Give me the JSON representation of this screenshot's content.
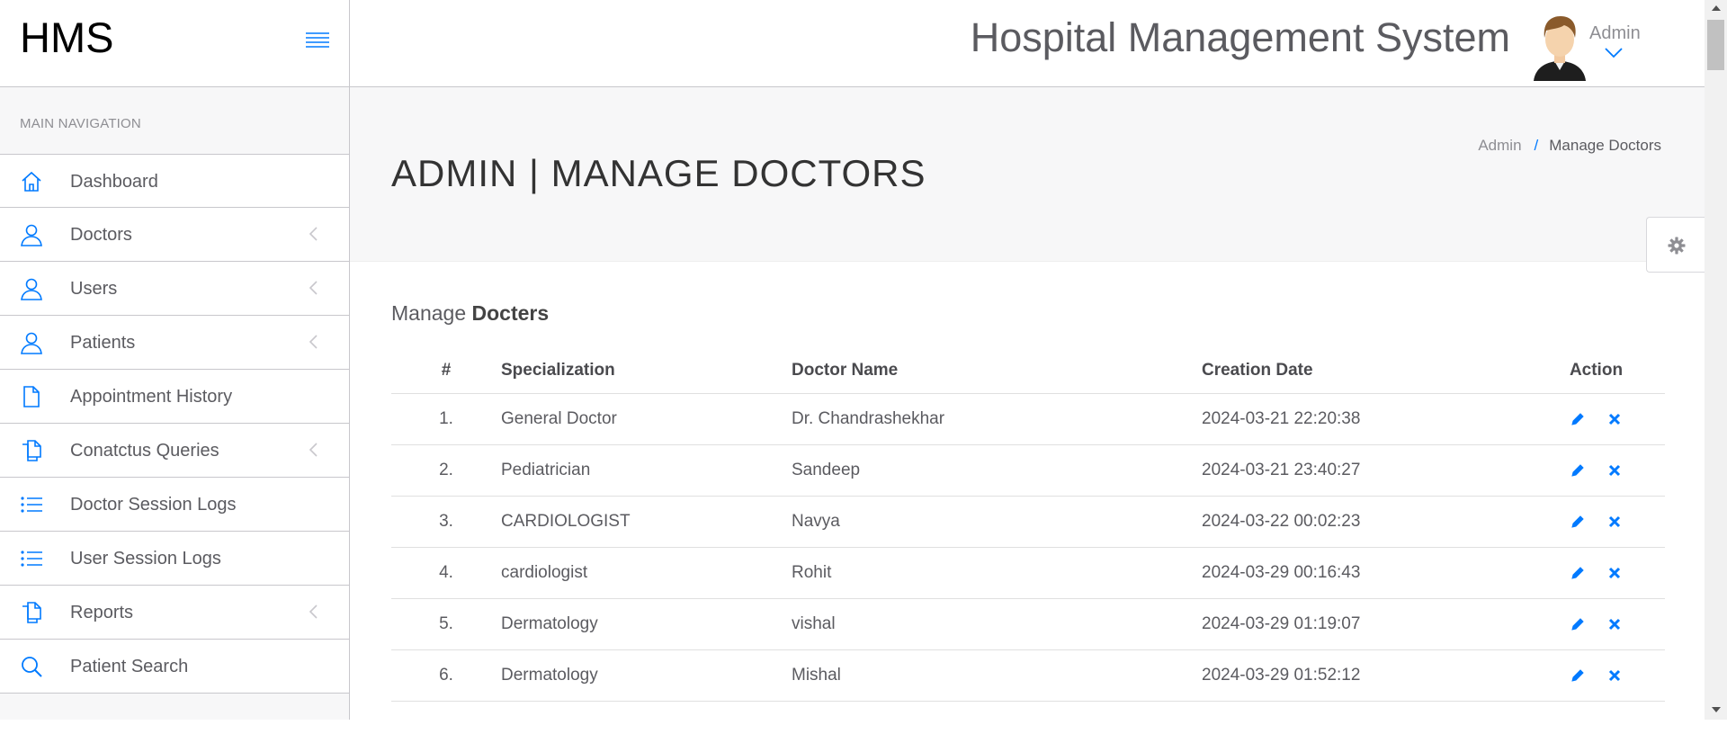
{
  "brand": {
    "logo": "HMS"
  },
  "topbar": {
    "title": "Hospital Management System",
    "user_name": "Admin"
  },
  "sidebar": {
    "header": "MAIN NAVIGATION",
    "items": [
      {
        "label": "Dashboard",
        "icon": "home-icon",
        "has_submenu": false
      },
      {
        "label": "Doctors",
        "icon": "user-icon",
        "has_submenu": true
      },
      {
        "label": "Users",
        "icon": "user-icon",
        "has_submenu": true
      },
      {
        "label": "Patients",
        "icon": "user-icon",
        "has_submenu": true
      },
      {
        "label": "Appointment History",
        "icon": "file-icon",
        "has_submenu": false
      },
      {
        "label": "Conatctus Queries",
        "icon": "files-icon",
        "has_submenu": true
      },
      {
        "label": "Doctor Session Logs",
        "icon": "list-icon",
        "has_submenu": false
      },
      {
        "label": "User Session Logs",
        "icon": "list-icon",
        "has_submenu": false
      },
      {
        "label": "Reports",
        "icon": "files-icon",
        "has_submenu": true
      },
      {
        "label": "Patient Search",
        "icon": "search-icon",
        "has_submenu": false
      }
    ]
  },
  "page": {
    "title": "ADMIN | MANAGE DOCTORS",
    "breadcrumb": {
      "root": "Admin",
      "separator": "/",
      "current": "Manage Doctors"
    }
  },
  "panel": {
    "title_prefix": "Manage",
    "title_bold": "Docters"
  },
  "table": {
    "headers": {
      "num": "#",
      "spec": "Specialization",
      "name": "Doctor Name",
      "date": "Creation Date",
      "action": "Action"
    },
    "rows": [
      {
        "num": "1.",
        "spec": "General Doctor",
        "name": "Dr. Chandrashekhar",
        "date": "2024-03-21 22:20:38"
      },
      {
        "num": "2.",
        "spec": "Pediatrician",
        "name": "Sandeep",
        "date": "2024-03-21 23:40:27"
      },
      {
        "num": "3.",
        "spec": "CARDIOLOGIST",
        "name": "Navya",
        "date": "2024-03-22 00:02:23"
      },
      {
        "num": "4.",
        "spec": "cardiologist",
        "name": "Rohit",
        "date": "2024-03-29 00:16:43"
      },
      {
        "num": "5.",
        "spec": "Dermatology",
        "name": "vishal",
        "date": "2024-03-29 01:19:07"
      },
      {
        "num": "6.",
        "spec": "Dermatology",
        "name": "Mishal",
        "date": "2024-03-29 01:52:12"
      }
    ]
  },
  "colors": {
    "accent": "#007aff",
    "text": "#5b5b60",
    "border": "#c8c7cc",
    "sidebar_bg": "#f7f7f8"
  }
}
